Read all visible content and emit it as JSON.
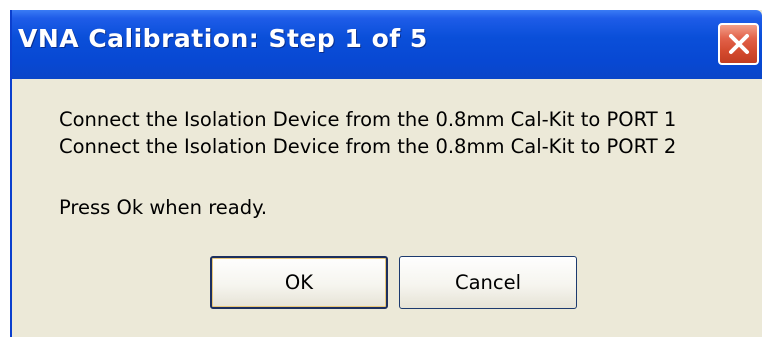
{
  "dialog": {
    "title": "VNA Calibration:  Step 1 of 5",
    "close_icon": "close-icon",
    "lines": [
      "Connect the Isolation Device from the 0.8mm Cal-Kit to PORT 1",
      "Connect the Isolation Device from the 0.8mm Cal-Kit to PORT 2",
      "Press Ok when ready."
    ],
    "buttons": {
      "ok": "OK",
      "cancel": "Cancel"
    }
  },
  "colors": {
    "titlebar": "#0a4fd9",
    "close_button": "#d34a2e",
    "dialog_background": "#ece9d8"
  }
}
